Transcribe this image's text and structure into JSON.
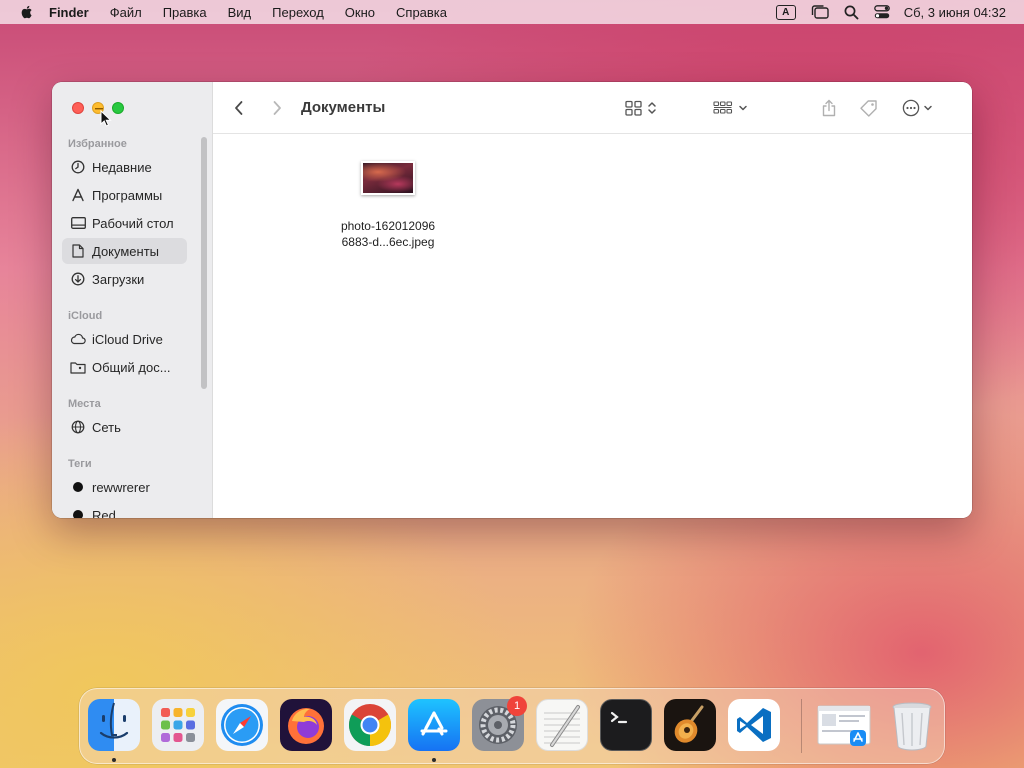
{
  "menubar": {
    "app_name": "Finder",
    "items": [
      "Файл",
      "Правка",
      "Вид",
      "Переход",
      "Окно",
      "Справка"
    ],
    "input_source": "A",
    "clock": "Сб, 3 июня  04:32"
  },
  "window": {
    "title": "Документы",
    "sidebar": {
      "favorites_header": "Избранное",
      "favorites": [
        "Недавние",
        "Программы",
        "Рабочий стол",
        "Документы",
        "Загрузки"
      ],
      "selected": "Документы",
      "icloud_header": "iCloud",
      "icloud": [
        "iCloud Drive",
        "Общий дос..."
      ],
      "places_header": "Места",
      "places": [
        "Сеть"
      ],
      "tags_header": "Теги",
      "tags": [
        "rewwrerer",
        "Red"
      ]
    },
    "files": [
      {
        "name_line1": "photo-162012096",
        "name_line2": "6883-d...6ec.jpeg"
      }
    ]
  },
  "dock": {
    "apps": [
      "Finder",
      "Launchpad",
      "Safari",
      "Firefox",
      "Google Chrome",
      "App Store",
      "System Settings",
      "TextEdit",
      "Terminal",
      "GarageBand",
      "Visual Studio Code",
      "Downloads",
      "Trash"
    ],
    "settings_badge": "1"
  },
  "colors": {
    "close": "#fe5f57",
    "minimize": "#febc2e",
    "zoom": "#28c840",
    "badge": "#f0433a"
  }
}
